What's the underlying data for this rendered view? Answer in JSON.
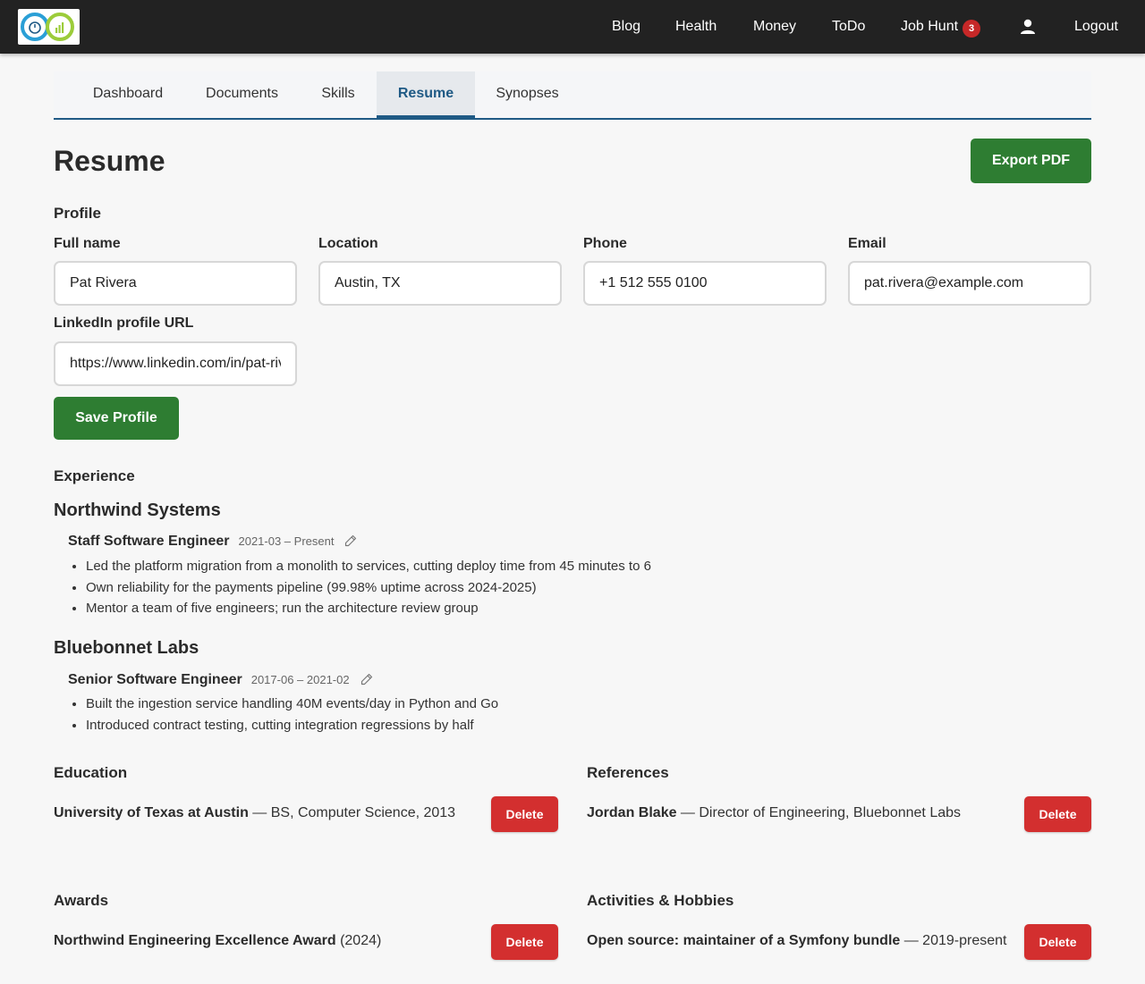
{
  "nav": {
    "links": [
      "Blog",
      "Health",
      "Money",
      "ToDo",
      "Job Hunt",
      "Logout"
    ],
    "job_hunt_badge": "3"
  },
  "tabs": [
    {
      "label": "Dashboard",
      "active": false
    },
    {
      "label": "Documents",
      "active": false
    },
    {
      "label": "Skills",
      "active": false
    },
    {
      "label": "Resume",
      "active": true
    },
    {
      "label": "Synopses",
      "active": false
    }
  ],
  "page": {
    "title": "Resume",
    "export_label": "Export PDF"
  },
  "profile": {
    "section_title": "Profile",
    "full_name_label": "Full name",
    "full_name": "Pat Rivera",
    "location_label": "Location",
    "location": "Austin, TX",
    "phone_label": "Phone",
    "phone": "+1 512 555 0100",
    "email_label": "Email",
    "email": "pat.rivera@example.com",
    "linkedin_label": "LinkedIn profile URL",
    "linkedin": "https://www.linkedin.com/in/pat-rivera",
    "save_label": "Save Profile"
  },
  "experience": {
    "section_title": "Experience",
    "companies": [
      {
        "name": "Northwind Systems",
        "role": "Staff Software Engineer",
        "dates": "2021-03 – Present",
        "bullets": [
          "Led the platform migration from a monolith to services, cutting deploy time from 45 minutes to 6",
          "Own reliability for the payments pipeline (99.98% uptime across 2024-2025)",
          "Mentor a team of five engineers; run the architecture review group"
        ]
      },
      {
        "name": "Bluebonnet Labs",
        "role": "Senior Software Engineer",
        "dates": "2017-06 – 2021-02",
        "bullets": [
          "Built the ingestion service handling 40M events/day in Python and Go",
          "Introduced contract testing, cutting integration regressions by half"
        ]
      }
    ]
  },
  "education": {
    "section_title": "Education",
    "item_bold": "University of Texas at Austin",
    "item_rest": " — BS, Computer Science, 2013",
    "delete_label": "Delete"
  },
  "references": {
    "section_title": "References",
    "item_bold": "Jordan Blake",
    "item_rest": " — Director of Engineering, Bluebonnet Labs",
    "delete_label": "Delete"
  },
  "awards": {
    "section_title": "Awards",
    "item_bold": "Northwind Engineering Excellence Award",
    "item_rest": " (2024)",
    "delete_label": "Delete"
  },
  "activities": {
    "section_title": "Activities & Hobbies",
    "item_bold": "Open source: maintainer of a Symfony bundle",
    "item_rest": " — 2019-present",
    "delete_label": "Delete"
  }
}
